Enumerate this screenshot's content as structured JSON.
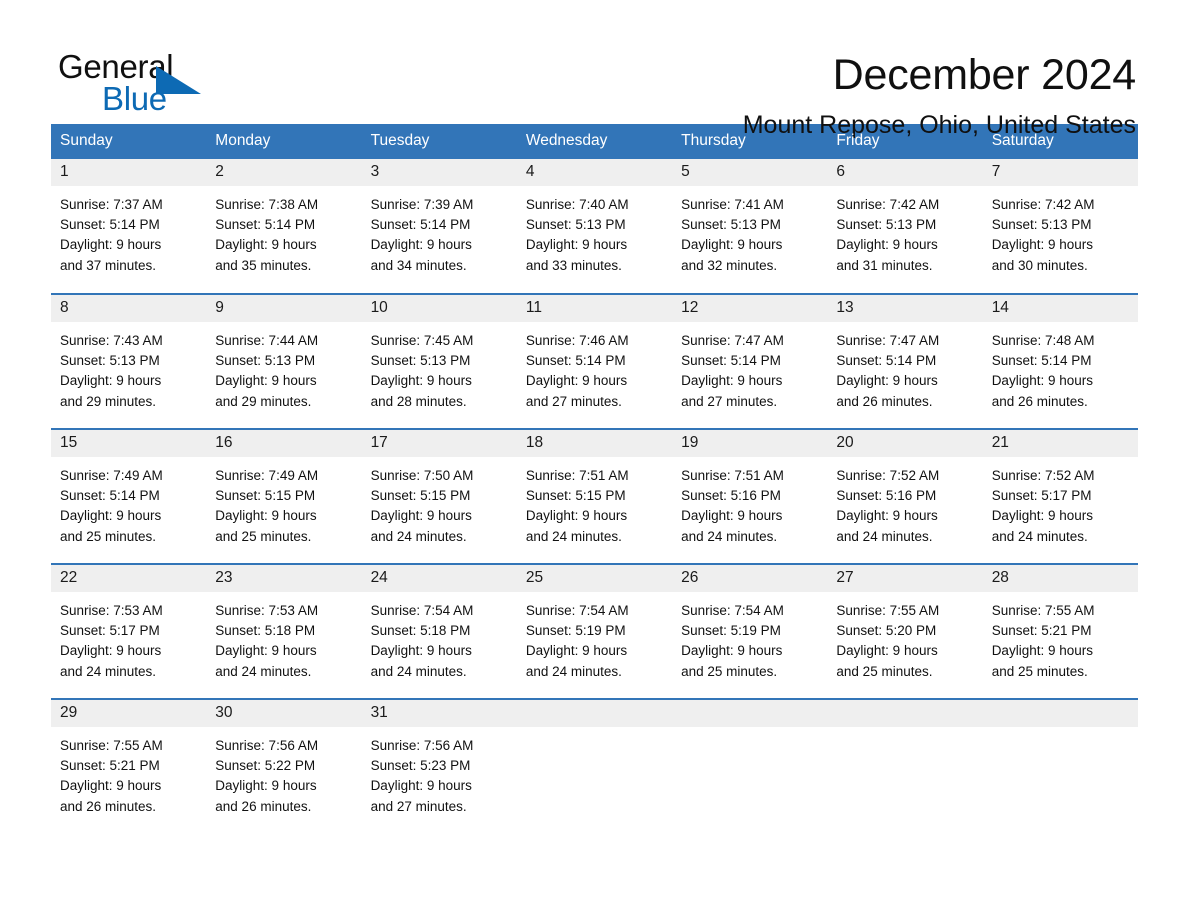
{
  "brand": {
    "name_part1": "General",
    "name_part2": "Blue",
    "accent_color": "#0d6ab4"
  },
  "header": {
    "title": "December 2024",
    "subtitle": "Mount Repose, Ohio, United States"
  },
  "calendar": {
    "header_bg": "#3275b8",
    "daynum_bg": "#efefef",
    "weekday_headers": [
      "Sunday",
      "Monday",
      "Tuesday",
      "Wednesday",
      "Thursday",
      "Friday",
      "Saturday"
    ],
    "weeks": [
      [
        {
          "day": "1",
          "sunrise": "Sunrise: 7:37 AM",
          "sunset": "Sunset: 5:14 PM",
          "daylight_line1": "Daylight: 9 hours",
          "daylight_line2": "and 37 minutes."
        },
        {
          "day": "2",
          "sunrise": "Sunrise: 7:38 AM",
          "sunset": "Sunset: 5:14 PM",
          "daylight_line1": "Daylight: 9 hours",
          "daylight_line2": "and 35 minutes."
        },
        {
          "day": "3",
          "sunrise": "Sunrise: 7:39 AM",
          "sunset": "Sunset: 5:14 PM",
          "daylight_line1": "Daylight: 9 hours",
          "daylight_line2": "and 34 minutes."
        },
        {
          "day": "4",
          "sunrise": "Sunrise: 7:40 AM",
          "sunset": "Sunset: 5:13 PM",
          "daylight_line1": "Daylight: 9 hours",
          "daylight_line2": "and 33 minutes."
        },
        {
          "day": "5",
          "sunrise": "Sunrise: 7:41 AM",
          "sunset": "Sunset: 5:13 PM",
          "daylight_line1": "Daylight: 9 hours",
          "daylight_line2": "and 32 minutes."
        },
        {
          "day": "6",
          "sunrise": "Sunrise: 7:42 AM",
          "sunset": "Sunset: 5:13 PM",
          "daylight_line1": "Daylight: 9 hours",
          "daylight_line2": "and 31 minutes."
        },
        {
          "day": "7",
          "sunrise": "Sunrise: 7:42 AM",
          "sunset": "Sunset: 5:13 PM",
          "daylight_line1": "Daylight: 9 hours",
          "daylight_line2": "and 30 minutes."
        }
      ],
      [
        {
          "day": "8",
          "sunrise": "Sunrise: 7:43 AM",
          "sunset": "Sunset: 5:13 PM",
          "daylight_line1": "Daylight: 9 hours",
          "daylight_line2": "and 29 minutes."
        },
        {
          "day": "9",
          "sunrise": "Sunrise: 7:44 AM",
          "sunset": "Sunset: 5:13 PM",
          "daylight_line1": "Daylight: 9 hours",
          "daylight_line2": "and 29 minutes."
        },
        {
          "day": "10",
          "sunrise": "Sunrise: 7:45 AM",
          "sunset": "Sunset: 5:13 PM",
          "daylight_line1": "Daylight: 9 hours",
          "daylight_line2": "and 28 minutes."
        },
        {
          "day": "11",
          "sunrise": "Sunrise: 7:46 AM",
          "sunset": "Sunset: 5:14 PM",
          "daylight_line1": "Daylight: 9 hours",
          "daylight_line2": "and 27 minutes."
        },
        {
          "day": "12",
          "sunrise": "Sunrise: 7:47 AM",
          "sunset": "Sunset: 5:14 PM",
          "daylight_line1": "Daylight: 9 hours",
          "daylight_line2": "and 27 minutes."
        },
        {
          "day": "13",
          "sunrise": "Sunrise: 7:47 AM",
          "sunset": "Sunset: 5:14 PM",
          "daylight_line1": "Daylight: 9 hours",
          "daylight_line2": "and 26 minutes."
        },
        {
          "day": "14",
          "sunrise": "Sunrise: 7:48 AM",
          "sunset": "Sunset: 5:14 PM",
          "daylight_line1": "Daylight: 9 hours",
          "daylight_line2": "and 26 minutes."
        }
      ],
      [
        {
          "day": "15",
          "sunrise": "Sunrise: 7:49 AM",
          "sunset": "Sunset: 5:14 PM",
          "daylight_line1": "Daylight: 9 hours",
          "daylight_line2": "and 25 minutes."
        },
        {
          "day": "16",
          "sunrise": "Sunrise: 7:49 AM",
          "sunset": "Sunset: 5:15 PM",
          "daylight_line1": "Daylight: 9 hours",
          "daylight_line2": "and 25 minutes."
        },
        {
          "day": "17",
          "sunrise": "Sunrise: 7:50 AM",
          "sunset": "Sunset: 5:15 PM",
          "daylight_line1": "Daylight: 9 hours",
          "daylight_line2": "and 24 minutes."
        },
        {
          "day": "18",
          "sunrise": "Sunrise: 7:51 AM",
          "sunset": "Sunset: 5:15 PM",
          "daylight_line1": "Daylight: 9 hours",
          "daylight_line2": "and 24 minutes."
        },
        {
          "day": "19",
          "sunrise": "Sunrise: 7:51 AM",
          "sunset": "Sunset: 5:16 PM",
          "daylight_line1": "Daylight: 9 hours",
          "daylight_line2": "and 24 minutes."
        },
        {
          "day": "20",
          "sunrise": "Sunrise: 7:52 AM",
          "sunset": "Sunset: 5:16 PM",
          "daylight_line1": "Daylight: 9 hours",
          "daylight_line2": "and 24 minutes."
        },
        {
          "day": "21",
          "sunrise": "Sunrise: 7:52 AM",
          "sunset": "Sunset: 5:17 PM",
          "daylight_line1": "Daylight: 9 hours",
          "daylight_line2": "and 24 minutes."
        }
      ],
      [
        {
          "day": "22",
          "sunrise": "Sunrise: 7:53 AM",
          "sunset": "Sunset: 5:17 PM",
          "daylight_line1": "Daylight: 9 hours",
          "daylight_line2": "and 24 minutes."
        },
        {
          "day": "23",
          "sunrise": "Sunrise: 7:53 AM",
          "sunset": "Sunset: 5:18 PM",
          "daylight_line1": "Daylight: 9 hours",
          "daylight_line2": "and 24 minutes."
        },
        {
          "day": "24",
          "sunrise": "Sunrise: 7:54 AM",
          "sunset": "Sunset: 5:18 PM",
          "daylight_line1": "Daylight: 9 hours",
          "daylight_line2": "and 24 minutes."
        },
        {
          "day": "25",
          "sunrise": "Sunrise: 7:54 AM",
          "sunset": "Sunset: 5:19 PM",
          "daylight_line1": "Daylight: 9 hours",
          "daylight_line2": "and 24 minutes."
        },
        {
          "day": "26",
          "sunrise": "Sunrise: 7:54 AM",
          "sunset": "Sunset: 5:19 PM",
          "daylight_line1": "Daylight: 9 hours",
          "daylight_line2": "and 25 minutes."
        },
        {
          "day": "27",
          "sunrise": "Sunrise: 7:55 AM",
          "sunset": "Sunset: 5:20 PM",
          "daylight_line1": "Daylight: 9 hours",
          "daylight_line2": "and 25 minutes."
        },
        {
          "day": "28",
          "sunrise": "Sunrise: 7:55 AM",
          "sunset": "Sunset: 5:21 PM",
          "daylight_line1": "Daylight: 9 hours",
          "daylight_line2": "and 25 minutes."
        }
      ],
      [
        {
          "day": "29",
          "sunrise": "Sunrise: 7:55 AM",
          "sunset": "Sunset: 5:21 PM",
          "daylight_line1": "Daylight: 9 hours",
          "daylight_line2": "and 26 minutes."
        },
        {
          "day": "30",
          "sunrise": "Sunrise: 7:56 AM",
          "sunset": "Sunset: 5:22 PM",
          "daylight_line1": "Daylight: 9 hours",
          "daylight_line2": "and 26 minutes."
        },
        {
          "day": "31",
          "sunrise": "Sunrise: 7:56 AM",
          "sunset": "Sunset: 5:23 PM",
          "daylight_line1": "Daylight: 9 hours",
          "daylight_line2": "and 27 minutes."
        },
        {
          "day": "",
          "sunrise": "",
          "sunset": "",
          "daylight_line1": "",
          "daylight_line2": ""
        },
        {
          "day": "",
          "sunrise": "",
          "sunset": "",
          "daylight_line1": "",
          "daylight_line2": ""
        },
        {
          "day": "",
          "sunrise": "",
          "sunset": "",
          "daylight_line1": "",
          "daylight_line2": ""
        },
        {
          "day": "",
          "sunrise": "",
          "sunset": "",
          "daylight_line1": "",
          "daylight_line2": ""
        }
      ]
    ]
  }
}
